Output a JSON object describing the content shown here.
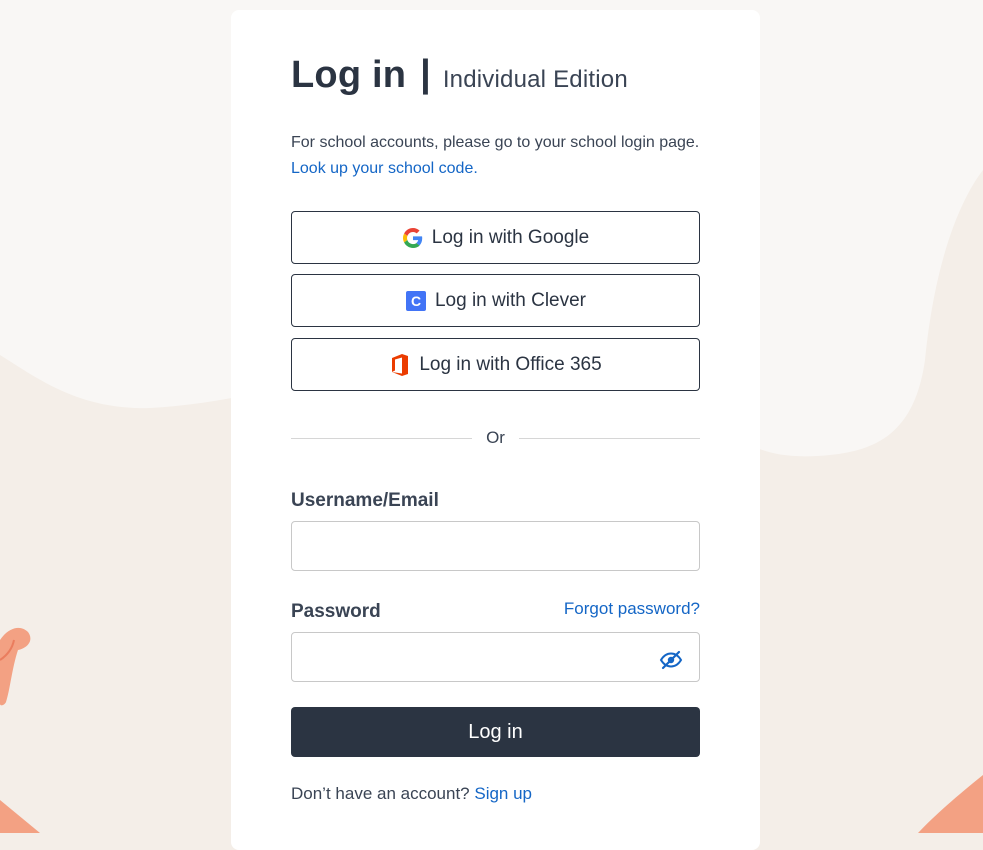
{
  "header": {
    "title": "Log in",
    "separator": "|",
    "edition": "Individual Edition"
  },
  "intro": {
    "text": "For school accounts, please go to your school login page.",
    "link": "Look up your school code."
  },
  "sso": {
    "google": {
      "label": "Log in with Google",
      "icon": "google-icon"
    },
    "clever": {
      "label": "Log in with Clever",
      "icon": "clever-icon",
      "icon_letter": "C"
    },
    "office": {
      "label": "Log in with Office 365",
      "icon": "office-365-icon"
    }
  },
  "divider": {
    "text": "Or"
  },
  "form": {
    "username": {
      "label": "Username/Email",
      "value": "",
      "placeholder": ""
    },
    "password": {
      "label": "Password",
      "value": "",
      "placeholder": ""
    },
    "forgot": "Forgot password?",
    "toggle_icon": "eye-slash-icon",
    "submit": "Log in"
  },
  "footer": {
    "prompt": "Don’t have an account?",
    "link": "Sign up"
  },
  "colors": {
    "primary": "#2b3442",
    "link": "#1466c6",
    "background": "#f4eee8",
    "accent_peach": "#f3a183"
  }
}
